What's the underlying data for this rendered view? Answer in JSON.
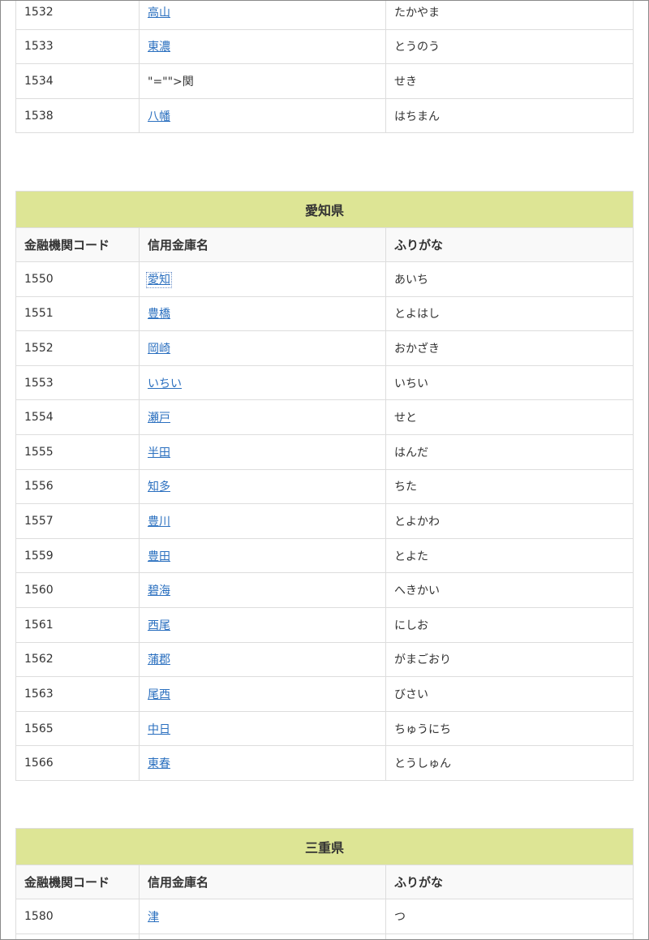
{
  "columns": {
    "code": "金融機関コード",
    "name": "信用金庫名",
    "kana": "ふりがな"
  },
  "top_rows": [
    {
      "code": "1532",
      "name": "高山",
      "kana": "たかやま",
      "link": true
    },
    {
      "code": "1533",
      "name": "東濃",
      "kana": "とうのう",
      "link": true
    },
    {
      "code": "1534",
      "name": "\"=\"\">関",
      "kana": "せき",
      "link": false
    },
    {
      "code": "1538",
      "name": "八幡",
      "kana": "はちまん",
      "link": true
    }
  ],
  "aichi": {
    "title": "愛知県",
    "rows": [
      {
        "code": "1550",
        "name": "愛知",
        "kana": "あいち",
        "link": true,
        "focused": true
      },
      {
        "code": "1551",
        "name": "豊橋",
        "kana": "とよはし",
        "link": true
      },
      {
        "code": "1552",
        "name": "岡崎",
        "kana": "おかざき",
        "link": true
      },
      {
        "code": "1553",
        "name": "いちい",
        "kana": "いちい",
        "link": true
      },
      {
        "code": "1554",
        "name": "瀬戸",
        "kana": "せと",
        "link": true
      },
      {
        "code": "1555",
        "name": "半田",
        "kana": "はんだ",
        "link": true
      },
      {
        "code": "1556",
        "name": "知多",
        "kana": "ちた",
        "link": true
      },
      {
        "code": "1557",
        "name": "豊川",
        "kana": "とよかわ",
        "link": true
      },
      {
        "code": "1559",
        "name": "豊田",
        "kana": "とよた",
        "link": true
      },
      {
        "code": "1560",
        "name": "碧海",
        "kana": "へきかい",
        "link": true
      },
      {
        "code": "1561",
        "name": "西尾",
        "kana": "にしお",
        "link": true
      },
      {
        "code": "1562",
        "name": "蒲郡",
        "kana": "がまごおり",
        "link": true
      },
      {
        "code": "1563",
        "name": "尾西",
        "kana": "びさい",
        "link": true
      },
      {
        "code": "1565",
        "name": "中日",
        "kana": "ちゅうにち",
        "link": true
      },
      {
        "code": "1566",
        "name": "東春",
        "kana": "とうしゅん",
        "link": true
      }
    ]
  },
  "mie": {
    "title": "三重県",
    "rows": [
      {
        "code": "1580",
        "name": "津",
        "kana": "つ",
        "link": true
      },
      {
        "code": "",
        "name": "",
        "kana": "",
        "link": false
      }
    ]
  },
  "colors": {
    "header_bg": "#dde595",
    "link": "#2a6fbf",
    "border": "#dddddd"
  }
}
